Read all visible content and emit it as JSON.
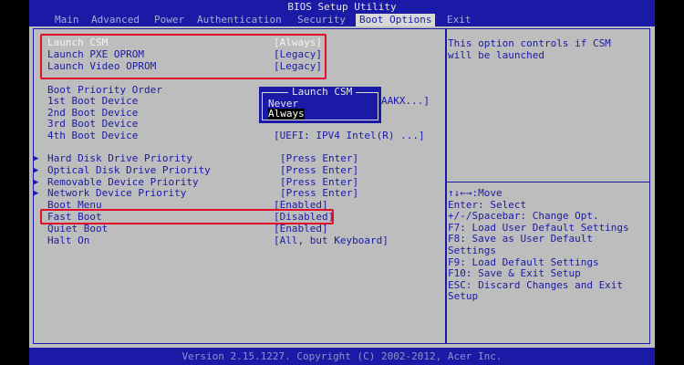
{
  "title": "BIOS Setup Utility",
  "menu": [
    "Main",
    "Advanced",
    "Power",
    "Authentication",
    "Security",
    "Boot Options",
    "Exit"
  ],
  "active_menu": "Boot Options",
  "settings": [
    {
      "label": "Launch CSM",
      "value": "[Always]"
    },
    {
      "label": "Launch PXE OPROM",
      "value": "[Legacy]"
    },
    {
      "label": "Launch Video OPROM",
      "value": "[Legacy]"
    }
  ],
  "boot_priority": {
    "heading": "Boot Priority Order",
    "items": [
      {
        "label": "1st Boot Device",
        "value": "AAKX...]"
      },
      {
        "label": "2nd Boot Device",
        "value": ""
      },
      {
        "label": "3rd Boot Device",
        "value": ""
      },
      {
        "label": "4th Boot Device",
        "value": "[UEFI: IPV4 Intel(R) ...]"
      }
    ]
  },
  "submenus": [
    {
      "label": "Hard Disk Drive Priority",
      "value": "[Press Enter]"
    },
    {
      "label": "Optical Disk Drive Priority",
      "value": "[Press Enter]"
    },
    {
      "label": "Removable Device Priority",
      "value": "[Press Enter]"
    },
    {
      "label": "Network Device Priority",
      "value": "[Press Enter]"
    }
  ],
  "options": [
    {
      "label": "Boot Menu",
      "value": "[Enabled]"
    },
    {
      "label": "Fast Boot",
      "value": "[Disabled]"
    },
    {
      "label": "Quiet Boot",
      "value": "[Enabled]"
    },
    {
      "label": "Halt On",
      "value": "[All, but Keyboard]"
    }
  ],
  "popup": {
    "title": "Launch CSM",
    "options": [
      "Never",
      "Always"
    ],
    "selected": "Always"
  },
  "help_text": "This option controls if CSM\nwill be launched",
  "key_help": "↑↓←→:Move\nEnter: Select\n+/-/Spacebar: Change Opt.\nF7: Load User Default Settings\nF8: Save as User Default\nSettings\nF9: Load Default Settings\nF10: Save & Exit Setup\nESC: Discard Changes and Exit\nSetup",
  "footer": "Version 2.15.1227. Copyright (C) 2002-2012, Acer Inc.",
  "colors": {
    "bios_blue": "#1a1aa6",
    "bios_gray": "#bdbdbd",
    "highlight_red": "#e0102a"
  }
}
